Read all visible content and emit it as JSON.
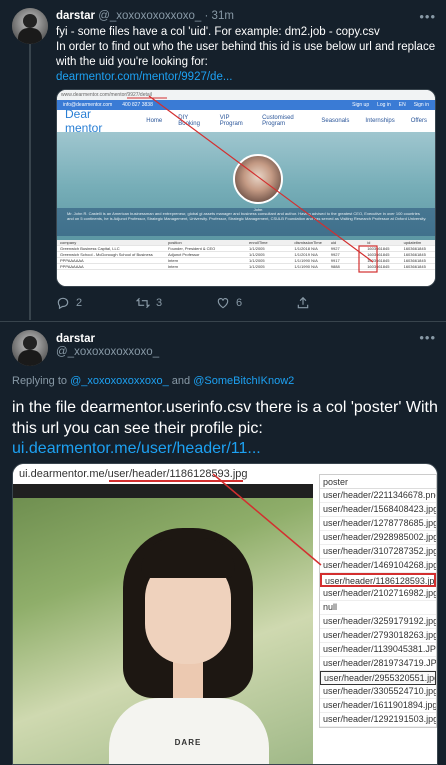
{
  "tweet1": {
    "name": "darstar",
    "handle": "@_xoxoxoxoxxoxo_",
    "separator": "·",
    "time": "31m",
    "more": "•••",
    "text": "fyi - some files have a col 'uid'. For example: dm2.job - copy.csv\nIn order to find out who the user behind this id is use below url and replace with the uid you're looking for:",
    "link": "dearmentor.com/mentor/9927/de...",
    "media": {
      "url_bar": "www.dearmentor.com/mentor/9927/detail",
      "nav_items": [
        "Home",
        "DIY Booking",
        "VIP Program",
        "Customised Program",
        "Seasonals",
        "Internships",
        "Offers"
      ],
      "logo": "Dear mentor",
      "top_links": [
        "Sign up",
        "Log in",
        "EN",
        "Sign in"
      ],
      "contact": "info@dearmentor.com",
      "phone": "400 827 3838",
      "bio": "Mr. John R. Castelli is an American businessman and entrepreneur, global gi assets manager and business consultant and author. Having advised to the greatest CEO, Executive in over 100 countries and on 5 continents, he is Adjunct Professor, Strategic Management, University. Professor, Strategic Management, CSULB Foundation and has served as Visiting Research Professor at Oxford University.",
      "portrait_caption": "John",
      "table_headers": [
        "company",
        "position",
        "enrollTime",
        "dismissionTime",
        "uid",
        "id",
        "updatetim"
      ],
      "table_rows": [
        [
          "Greenwich Business Capital, LLC",
          "Founder, President & CEO",
          "1/1/2005",
          "1/1/2018 N/A",
          "9927",
          "1603661845",
          "1603661845"
        ],
        [
          "Greenwich School - McDonough School of Business",
          "Adjunct Professor",
          "1/1/2005",
          "1/1/2019 N/A",
          "9927",
          "1603661845",
          "1603661845"
        ],
        [
          "PPPAAAAAA",
          "Intern",
          "1/1/2005",
          "1/1/1990 N/A",
          "9917",
          "1603661845",
          "1603661845"
        ],
        [
          "PPPAAAAAA",
          "Intern",
          "1/1/2005",
          "1/1/1990 N/A",
          "9888",
          "1603661845",
          "1603661845"
        ]
      ]
    },
    "actions": {
      "reply_count": "2",
      "retweet_count": "3",
      "like_count": "6"
    }
  },
  "tweet2": {
    "name": "darstar",
    "handle": "@_xoxoxoxoxxoxo_",
    "more": "•••",
    "replying_prefix": "Replying to",
    "replying_to": "@_xoxoxoxoxxoxo_",
    "replying_and": "and",
    "replying_to2": "@SomeBitchIKnow2",
    "text": "in the file dearmentor.userinfo.csv there is a col 'poster' With this url you can see their profile pic:",
    "link": "ui.dearmentor.me/user/header/11...",
    "media": {
      "url_host": "ui.dearmentor.me",
      "url_path": "/user/header/1186128593.jpg",
      "shirt_text": "DARE",
      "list_header": "poster",
      "list_items": [
        "user/header/2211346678.png",
        "user/header/1568408423.jpg",
        "user/header/1278778685.jpg",
        "user/header/2928985002.jpg",
        "user/header/3107287352.jpg",
        "user/header/1469104268.jpg",
        "user/header/1186128593.jpg",
        "user/header/2102716982.jpg",
        "null",
        "user/header/3259179192.jpg",
        "user/header/2793018263.jpg",
        "user/header/1139045381.JPG",
        "user/header/2819734719.JPG",
        "user/header/2955320551.jpg",
        "user/header/3305524710.jpg",
        "user/header/1611901894.jpg",
        "user/header/1292191503.jpg"
      ],
      "highlighted_index": 6,
      "selected_index": 13
    }
  },
  "colors": {
    "background": "#15202b",
    "text": "#ffffff",
    "muted": "#8899a6",
    "link": "#1da1f2",
    "annotation": "#d32f2f"
  }
}
